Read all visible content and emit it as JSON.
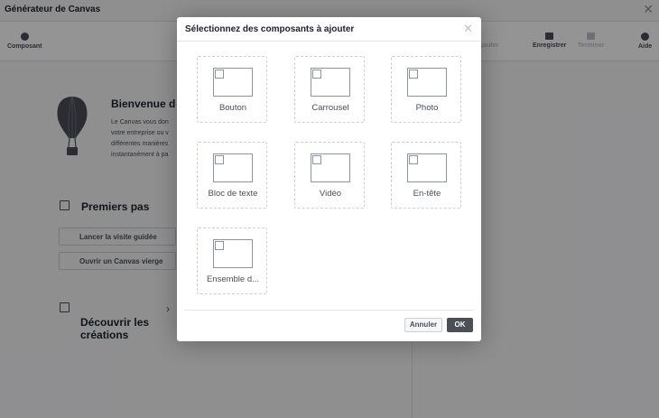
{
  "window": {
    "title": "Générateur de Canvas"
  },
  "toolbar": {
    "composant": "Composant",
    "ajouter": "Ajouter",
    "enregistrer": "Enregistrer",
    "terminer": "Terminer",
    "aide": "Aide"
  },
  "welcome": {
    "title": "Bienvenue d",
    "lines": [
      "Le Canvas vous don",
      "votre entreprise ou v",
      "différentes manières",
      "instantanément à pa"
    ]
  },
  "premiers_pas": {
    "title": "Premiers pas",
    "visite": "Lancer la visite guidée",
    "vierge": "Ouvrir un Canvas vierge"
  },
  "decouvrir": {
    "title": "Découvrir les créations"
  },
  "modal": {
    "title": "Sélectionnez des composants à ajouter",
    "components": [
      "Bouton",
      "Carrousel",
      "Photo",
      "Bloc de texte",
      "Vidéo",
      "En-tête",
      "Ensemble d..."
    ],
    "cancel": "Annuler",
    "ok": "OK"
  }
}
